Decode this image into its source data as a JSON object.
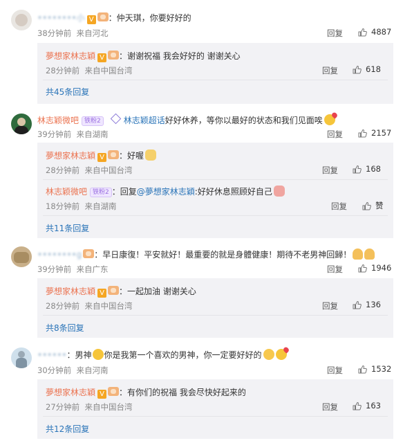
{
  "labels": {
    "reply": "回复",
    "like_text": "赞",
    "from": "来自"
  },
  "colors": {
    "username": "#eb7350",
    "link": "#2a74b8",
    "meta": "#888888",
    "sub_bg": "#f2f2f5"
  },
  "comments": [
    {
      "user": "••••••••小",
      "text": "：仲天琪，你要好好的",
      "time": "38分钟前",
      "location": "来自河北",
      "likes": "4887",
      "replies": [
        {
          "user": "夢想家林志穎",
          "text": "：谢谢祝福 我会好好的 谢谢关心",
          "time": "28分钟前",
          "location": "来自中国台湾",
          "likes": "618"
        }
      ],
      "more": "共45条回复"
    },
    {
      "user": "林志颖微吧",
      "fans_badge": "铁粉2",
      "tag": "林志颖超话",
      "text": "好好休养，等你以最好的状态和我们见面唉",
      "time": "39分钟前",
      "location": "来自湖南",
      "likes": "2157",
      "replies": [
        {
          "user": "夢想家林志穎",
          "text": "：好喔",
          "time": "28分钟前",
          "location": "来自中国台湾",
          "likes": "168"
        },
        {
          "user": "林志颖微吧",
          "fans_badge": "铁粉2",
          "reply_prefix": "：回复",
          "mention": "@夢想家林志穎",
          "text": ":好好休息照顾好自己",
          "time": "18分钟前",
          "location": "来自湖南",
          "likes": "赞"
        }
      ],
      "more": "共11条回复"
    },
    {
      "user": "••••••••g",
      "text": "：早日康復！平安就好！最重要的就是身體健康！期待不老男神回歸！",
      "time": "39分钟前",
      "location": "来自广东",
      "likes": "1946",
      "replies": [
        {
          "user": "夢想家林志穎",
          "text": "：一起加油 谢谢关心",
          "time": "28分钟前",
          "location": "来自中国台湾",
          "likes": "136"
        }
      ],
      "more": "共8条回复"
    },
    {
      "user": "••••••",
      "text1": "：男神",
      "text2": "你是我第一个喜欢的男神，你一定要好好的",
      "time": "30分钟前",
      "location": "来自河南",
      "likes": "1532",
      "replies": [
        {
          "user": "夢想家林志穎",
          "text": "：有你们的祝福 我会尽快好起来的",
          "time": "27分钟前",
          "location": "来自中国台湾",
          "likes": "163"
        }
      ],
      "more": "共12条回复"
    }
  ]
}
